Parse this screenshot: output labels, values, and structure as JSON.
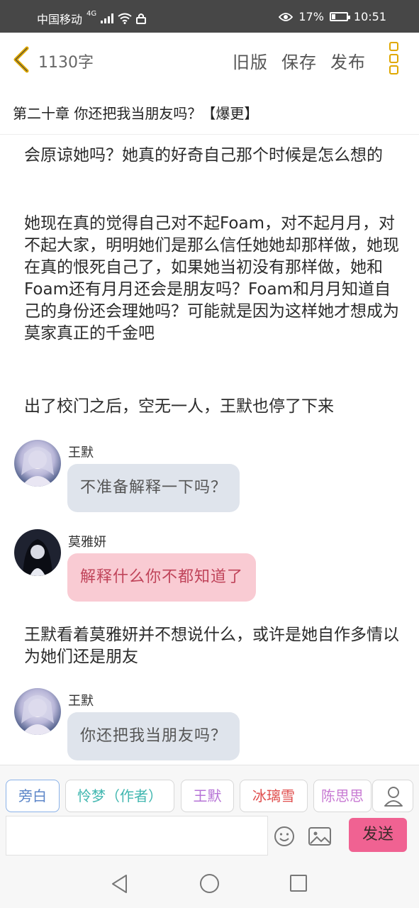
{
  "status_bar": {
    "carrier": "中国移动",
    "network": "4G",
    "battery_percent": "17%",
    "time": "10:51"
  },
  "toolbar": {
    "word_count": "1130字",
    "old_version": "旧版",
    "save": "保存",
    "publish": "发布"
  },
  "chapter": {
    "title": "第二十章 你还把我当朋友吗？【爆更】"
  },
  "content": {
    "paragraph_1": "会原谅她吗？她真的好奇自己那个时候是怎么想的",
    "paragraph_2": "她现在真的觉得自己对不起Foam，对不起月月，对不起大家，明明她们是那么信任她她却那样做，她现在真的恨死自己了，如果她当初没有那样做，她和Foam还有月月还会是朋友吗？Foam和月月知道自己的身份还会理她吗？可能就是因为这样她才想成为莫家真正的千金吧",
    "paragraph_3": "出了校门之后，空无一人，王默也停了下来",
    "paragraph_4": "王默看着莫雅妍并不想说什么，或许是她自作多情以为她们还是朋友"
  },
  "messages": [
    {
      "name": "王默",
      "text": "不准备解释一下吗？"
    },
    {
      "name": "莫雅妍",
      "text": "解释什么你不都知道了"
    },
    {
      "name": "王默",
      "text": "你还把我当朋友吗？"
    }
  ],
  "roles": {
    "narration": "旁白",
    "author": "怜梦（作者）",
    "char_1": "王默",
    "char_2": "冰璃雪",
    "char_3": "陈思思"
  },
  "input": {
    "placeholder": "",
    "send": "发送"
  },
  "colors": {
    "send_button": "#f06292",
    "accent_yellow": "#e0a800",
    "bubble_grey": "#dfe4ec",
    "bubble_pink": "#f9cbd3"
  }
}
